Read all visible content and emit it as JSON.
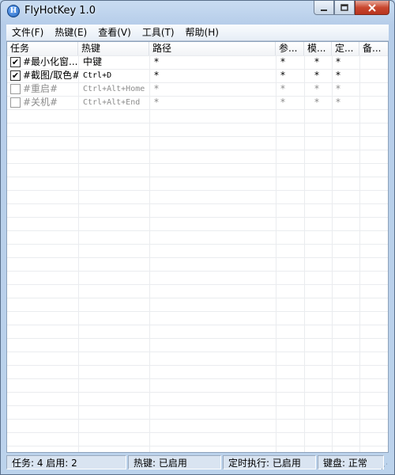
{
  "window": {
    "title": "FlyHotKey 1.0",
    "app_icon_glyph": "H"
  },
  "caption_buttons": {
    "minimize": "minimize-icon",
    "maximize": "maximize-icon",
    "close": "close-icon"
  },
  "menu": [
    {
      "label": "文件(F)"
    },
    {
      "label": "热键(E)"
    },
    {
      "label": "查看(V)"
    },
    {
      "label": "工具(T)"
    },
    {
      "label": "帮助(H)"
    }
  ],
  "columns": [
    "任务",
    "热键",
    "路径",
    "参...",
    "模...",
    "定...",
    "备..."
  ],
  "rows": [
    {
      "checked": true,
      "task": "#最小化窗...",
      "hotkey": "中键",
      "path": "*",
      "params": "*",
      "mode": "*",
      "timer": "*",
      "note": ""
    },
    {
      "checked": true,
      "task": "#截图/取色#",
      "hotkey": "Ctrl+D",
      "path": "*",
      "params": "*",
      "mode": "*",
      "timer": "*",
      "note": ""
    },
    {
      "checked": false,
      "task": "#重启#",
      "hotkey": "Ctrl+Alt+Home",
      "path": "*",
      "params": "*",
      "mode": "*",
      "timer": "*",
      "note": ""
    },
    {
      "checked": false,
      "task": "#关机#",
      "hotkey": "Ctrl+Alt+End",
      "path": "*",
      "params": "*",
      "mode": "*",
      "timer": "*",
      "note": ""
    }
  ],
  "status": {
    "tasks": "任务: 4  启用: 2",
    "hotkey": "热键: 已启用",
    "timer": "定时执行: 已启用",
    "keyboard": "键盘: 正常"
  },
  "colors": {
    "titlebar": "#bcd3ec",
    "close_button": "#c9472f",
    "disabled_text": "#8c8c8c"
  }
}
